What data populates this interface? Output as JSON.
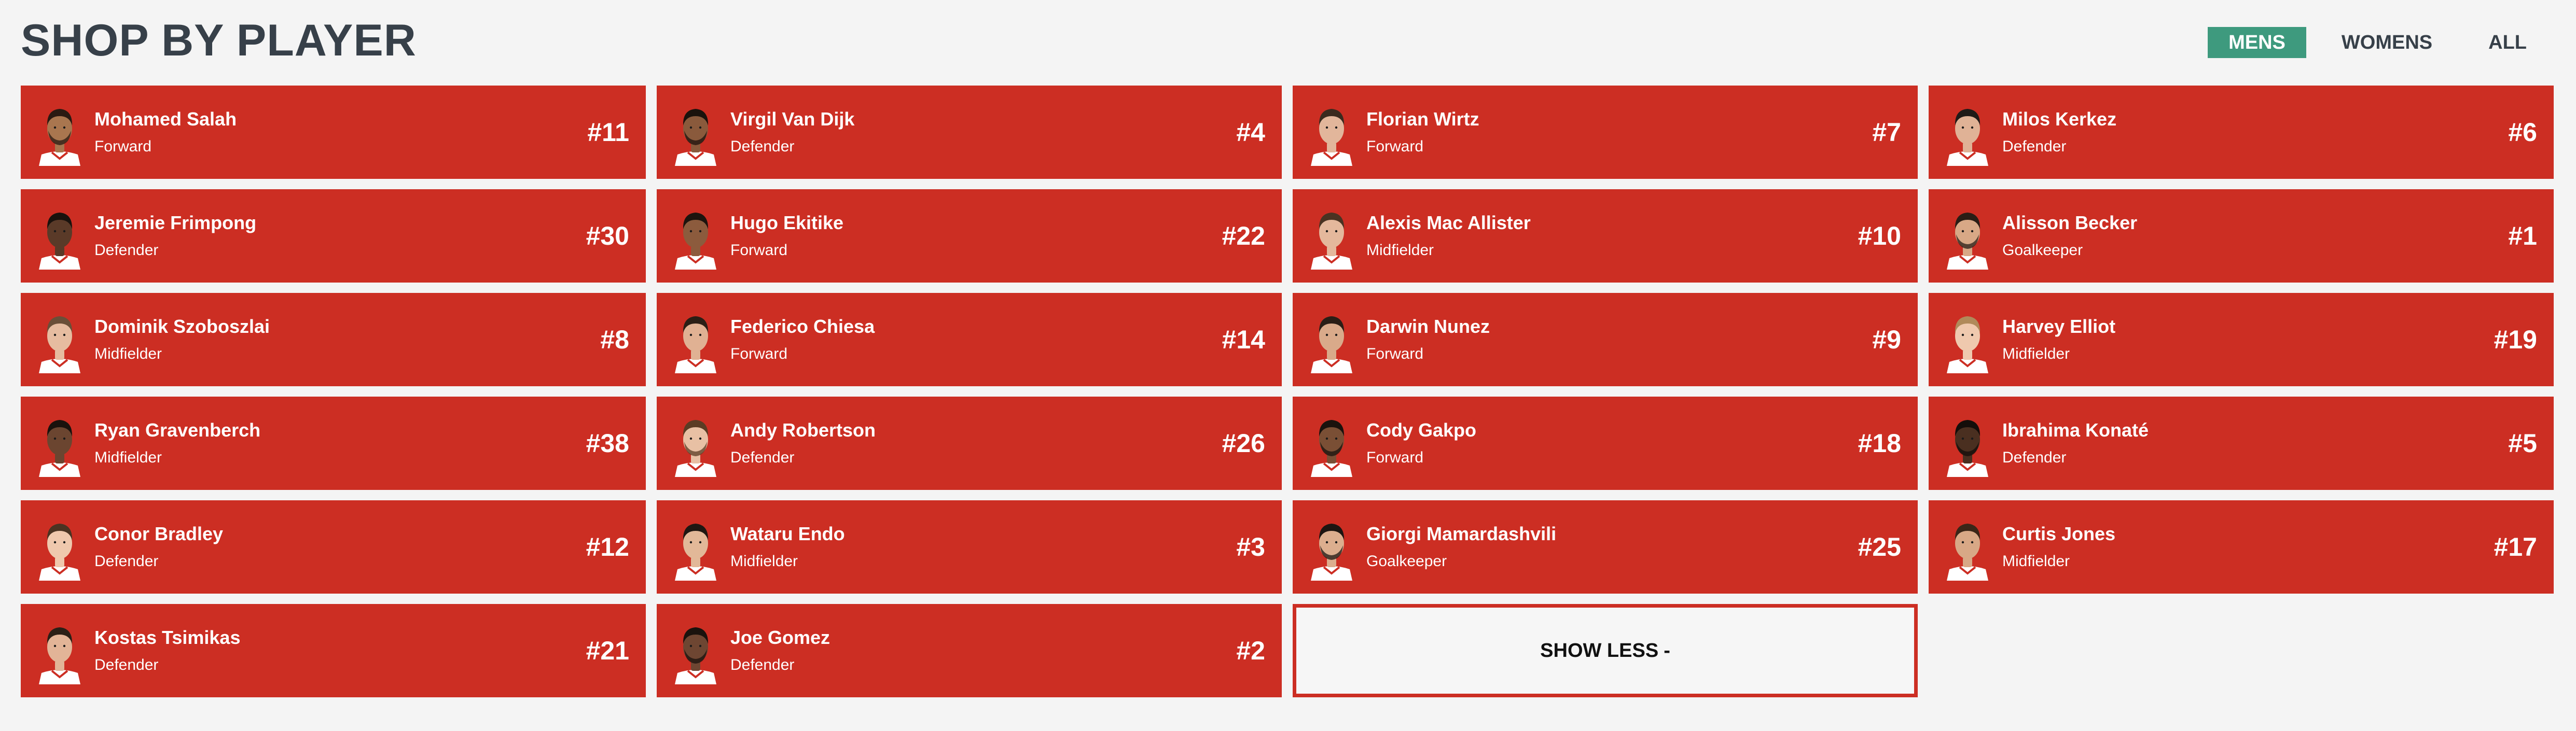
{
  "page": {
    "title": "SHOP BY PLAYER"
  },
  "filters": [
    {
      "label": "MENS",
      "active": true
    },
    {
      "label": "WOMENS",
      "active": false
    },
    {
      "label": "ALL",
      "active": false
    }
  ],
  "players": [
    {
      "name": "Mohamed Salah",
      "position": "Forward",
      "number": "#11",
      "skin": "#a9764f",
      "hair": "#2a1a12",
      "beard": true
    },
    {
      "name": "Virgil Van Dijk",
      "position": "Defender",
      "number": "#4",
      "skin": "#8a5a3c",
      "hair": "#1b120c",
      "beard": true
    },
    {
      "name": "Florian Wirtz",
      "position": "Forward",
      "number": "#7",
      "skin": "#e2b69b",
      "hair": "#3a2a1e",
      "beard": false
    },
    {
      "name": "Milos Kerkez",
      "position": "Defender",
      "number": "#6",
      "skin": "#e0b296",
      "hair": "#1f1a17",
      "beard": false
    },
    {
      "name": "Jeremie Frimpong",
      "position": "Defender",
      "number": "#30",
      "skin": "#5a3a28",
      "hair": "#1a120d",
      "beard": false
    },
    {
      "name": "Hugo Ekitike",
      "position": "Forward",
      "number": "#22",
      "skin": "#8c5b3d",
      "hair": "#1d140e",
      "beard": false
    },
    {
      "name": "Alexis Mac Allister",
      "position": "Midfielder",
      "number": "#10",
      "skin": "#e4b89c",
      "hair": "#4a3322",
      "beard": false
    },
    {
      "name": "Alisson Becker",
      "position": "Goalkeeper",
      "number": "#1",
      "skin": "#d8a886",
      "hair": "#2a1d15",
      "beard": true
    },
    {
      "name": "Dominik Szoboszlai",
      "position": "Midfielder",
      "number": "#8",
      "skin": "#e6bca0",
      "hair": "#6a4f38",
      "beard": false
    },
    {
      "name": "Federico Chiesa",
      "position": "Forward",
      "number": "#14",
      "skin": "#e0b193",
      "hair": "#2b1e15",
      "beard": false
    },
    {
      "name": "Darwin Nunez",
      "position": "Forward",
      "number": "#9",
      "skin": "#d9aa8a",
      "hair": "#2a1e16",
      "beard": false
    },
    {
      "name": "Harvey Elliot",
      "position": "Midfielder",
      "number": "#19",
      "skin": "#efc9ae",
      "hair": "#b08a5a",
      "beard": false
    },
    {
      "name": "Ryan Gravenberch",
      "position": "Midfielder",
      "number": "#38",
      "skin": "#6b4530",
      "hair": "#1a120d",
      "beard": false
    },
    {
      "name": "Andy Robertson",
      "position": "Defender",
      "number": "#26",
      "skin": "#e8c0a4",
      "hair": "#5b3c24",
      "beard": true
    },
    {
      "name": "Cody Gakpo",
      "position": "Forward",
      "number": "#18",
      "skin": "#7a4f35",
      "hair": "#1a120d",
      "beard": true
    },
    {
      "name": "Ibrahima Konaté",
      "position": "Defender",
      "number": "#5",
      "skin": "#4a2f20",
      "hair": "#140e0a",
      "beard": true
    },
    {
      "name": "Conor Bradley",
      "position": "Defender",
      "number": "#12",
      "skin": "#efc8ad",
      "hair": "#4a3322",
      "beard": false
    },
    {
      "name": "Wataru Endo",
      "position": "Midfielder",
      "number": "#3",
      "skin": "#e2b898",
      "hair": "#1f1712",
      "beard": false
    },
    {
      "name": "Giorgi Mamardashvili",
      "position": "Goalkeeper",
      "number": "#25",
      "skin": "#dcae8e",
      "hair": "#1d1511",
      "beard": true
    },
    {
      "name": "Curtis Jones",
      "position": "Midfielder",
      "number": "#17",
      "skin": "#d8a886",
      "hair": "#3a2618",
      "beard": false
    },
    {
      "name": "Kostas Tsimikas",
      "position": "Defender",
      "number": "#21",
      "skin": "#e2b497",
      "hair": "#2b1f16",
      "beard": false
    },
    {
      "name": "Joe Gomez",
      "position": "Defender",
      "number": "#2",
      "skin": "#6e4632",
      "hair": "#1a120d",
      "beard": true
    }
  ],
  "show_less": {
    "label": "SHOW LESS",
    "symbol": "-"
  }
}
